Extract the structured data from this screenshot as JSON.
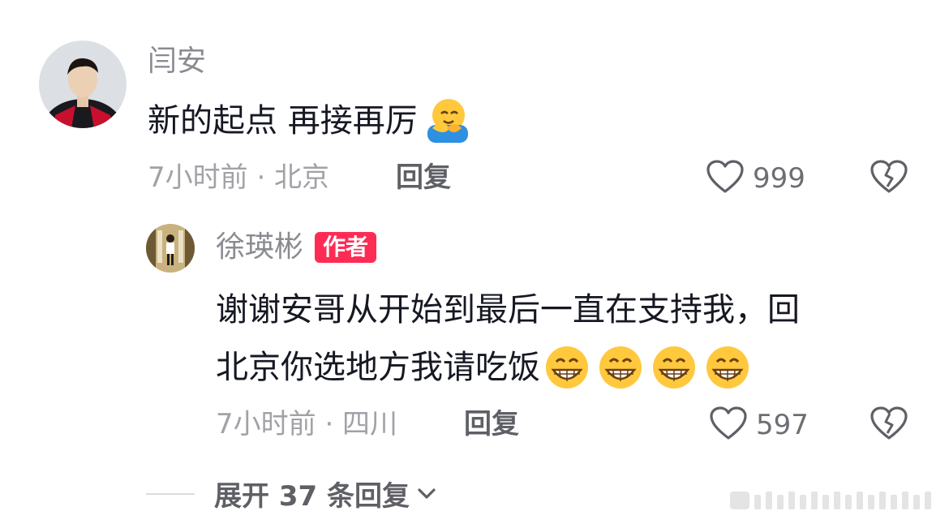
{
  "comment": {
    "author": "闫安",
    "text": "新的起点 再接再厉",
    "emoji": "hugging-face",
    "time_location": "7小时前 · 北京",
    "reply_label": "回复",
    "like_count": "999"
  },
  "reply": {
    "author": "徐瑛彬",
    "author_badge": "作者",
    "text_line1": "谢谢安哥从开始到最后一直在支持我，回",
    "text_line2": "北京你选地方我请吃饭",
    "emoji": "grinning-face",
    "time_location": "7小时前 · 四川",
    "reply_label": "回复",
    "like_count": "597"
  },
  "expand": {
    "label": "展开 37 条回复"
  },
  "colors": {
    "badge": "#fe2c55",
    "muted_text": "#a1a2a7",
    "name_text": "#8a8b91"
  }
}
